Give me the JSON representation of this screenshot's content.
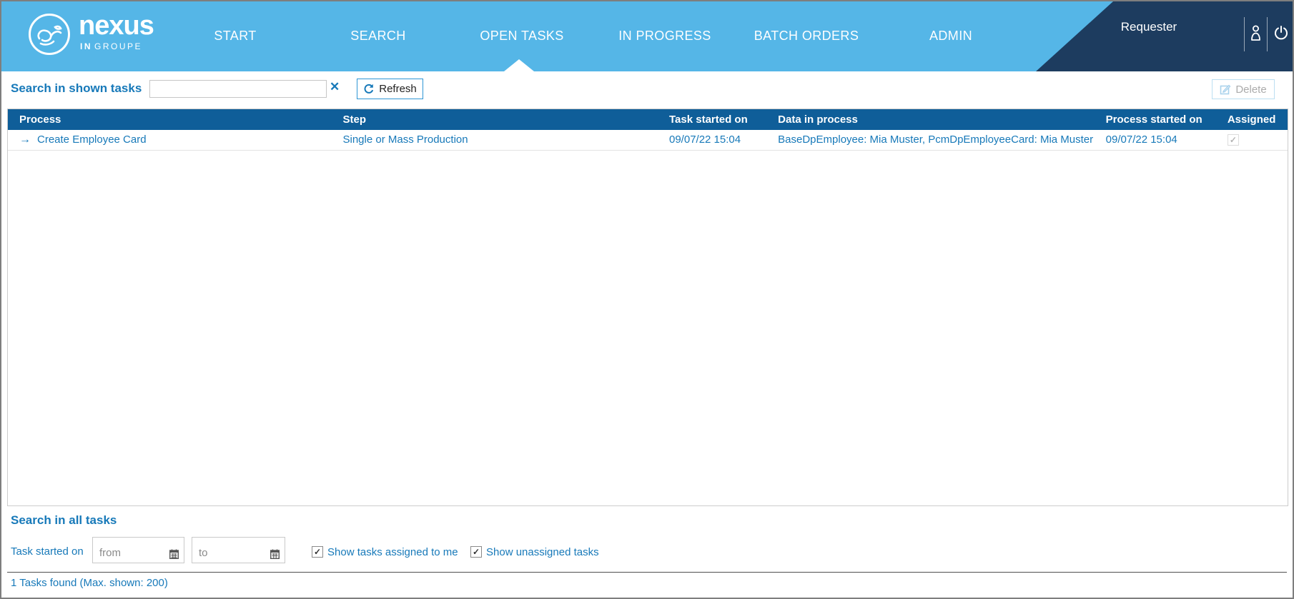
{
  "header": {
    "logo": {
      "brand": "nexus",
      "sub_in": "IN",
      "sub_rest": "GROUPE"
    },
    "nav": [
      {
        "label": "START",
        "active": false
      },
      {
        "label": "SEARCH",
        "active": false
      },
      {
        "label": "OPEN TASKS",
        "active": true
      },
      {
        "label": "IN PROGRESS",
        "active": false
      },
      {
        "label": "BATCH ORDERS",
        "active": false
      },
      {
        "label": "ADMIN",
        "active": false
      }
    ],
    "user_role": "Requester"
  },
  "icons": {
    "arrow_right": "→",
    "check": "✓",
    "clear": "✕"
  },
  "toolbar": {
    "search_label": "Search in shown tasks",
    "search_value": "",
    "refresh_label": "Refresh",
    "delete_label": "Delete"
  },
  "table": {
    "columns": [
      "Process",
      "Step",
      "Task started on",
      "Data in process",
      "Process started on",
      "Assigned"
    ],
    "rows": [
      {
        "process": "Create Employee Card",
        "step": "Single or Mass Production",
        "task_started": "09/07/22 15:04",
        "data_in_process": "BaseDpEmployee: Mia Muster, PcmDpEmployeeCard: Mia Muster",
        "process_started": "09/07/22 15:04",
        "assigned": true
      }
    ]
  },
  "search_all": {
    "title": "Search in all tasks",
    "task_started_label": "Task started on",
    "from_placeholder": "from",
    "to_placeholder": "to",
    "checkbox_assigned_label": "Show tasks assigned to me",
    "checkbox_assigned_checked": true,
    "checkbox_unassigned_label": "Show unassigned tasks",
    "checkbox_unassigned_checked": true
  },
  "footer": {
    "status": "1 Tasks found (Max. shown: 200)"
  },
  "colors": {
    "header_blue": "#55b6e7",
    "navy": "#1d3c5f",
    "table_header_blue": "#0f5e99",
    "link_blue": "#1779b9"
  }
}
